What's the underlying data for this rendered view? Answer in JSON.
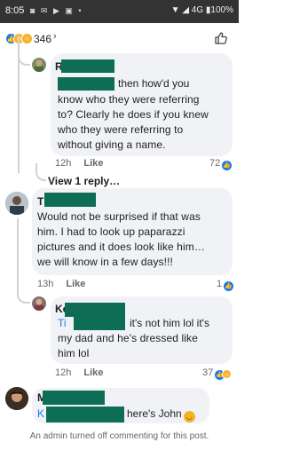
{
  "status_bar": {
    "time": "8:05",
    "left_icons": "◙ ✉ ▶ ▣ •",
    "right_text": "▼ ◢ 4G ▮100%"
  },
  "reactions": {
    "count": "346",
    "chevron": "›"
  },
  "comments": [
    {
      "name": "R",
      "lines": [
        "then how'd you",
        "know who they were referring",
        "to? Clearly he does if you knew",
        "who they were referring to",
        "without giving a name."
      ],
      "time": "12h",
      "like": "Like",
      "count": "72"
    },
    {
      "view_replies": "View 1 reply…"
    },
    {
      "name": "T",
      "lines": [
        "Would not be surprised if that was",
        "him. I had to look up paparazzi",
        "pictures and it does look like him…",
        "we will know in a few days!!!"
      ],
      "time": "13h",
      "like": "Like",
      "count": "1"
    },
    {
      "name": "Ko",
      "tag": "Ti",
      "inline_text": "it's not him lol it's",
      "lines": [
        "my dad and he's dressed like",
        "him lol"
      ],
      "time": "12h",
      "like": "Like",
      "count": "37"
    },
    {
      "name": "M",
      "tag": "K",
      "inline_text": "here's John"
    }
  ],
  "footer": {
    "admin_note": "An admin turned off commenting for this post."
  },
  "colors": {
    "bubble": "#f0f2f5",
    "facebook_blue": "#1877f2",
    "redaction": "#0d6e55",
    "meta_gray": "#65676b"
  }
}
